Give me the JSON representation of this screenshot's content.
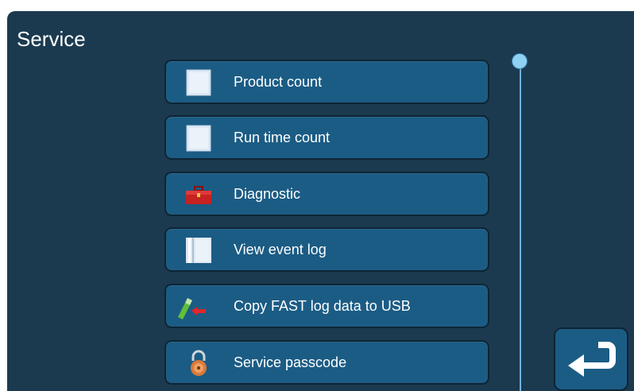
{
  "screen": {
    "title": "Service"
  },
  "menu": {
    "items": [
      {
        "label": "Product count",
        "icon": "document-icon"
      },
      {
        "label": "Run time count",
        "icon": "document-icon"
      },
      {
        "label": "Diagnostic",
        "icon": "toolbox-icon"
      },
      {
        "label": "View event log",
        "icon": "log-book-icon"
      },
      {
        "label": "Copy FAST log data to USB",
        "icon": "usb-copy-icon"
      },
      {
        "label": "Service passcode",
        "icon": "padlock-icon"
      }
    ]
  },
  "navigation": {
    "back_icon": "return-arrow-icon"
  },
  "scroll": {
    "position": 0
  },
  "colors": {
    "background": "#1b3a50",
    "button": "#1b5c85",
    "button_border": "#0f2433",
    "scroll_track": "#6fb3de",
    "text": "#ffffff"
  }
}
